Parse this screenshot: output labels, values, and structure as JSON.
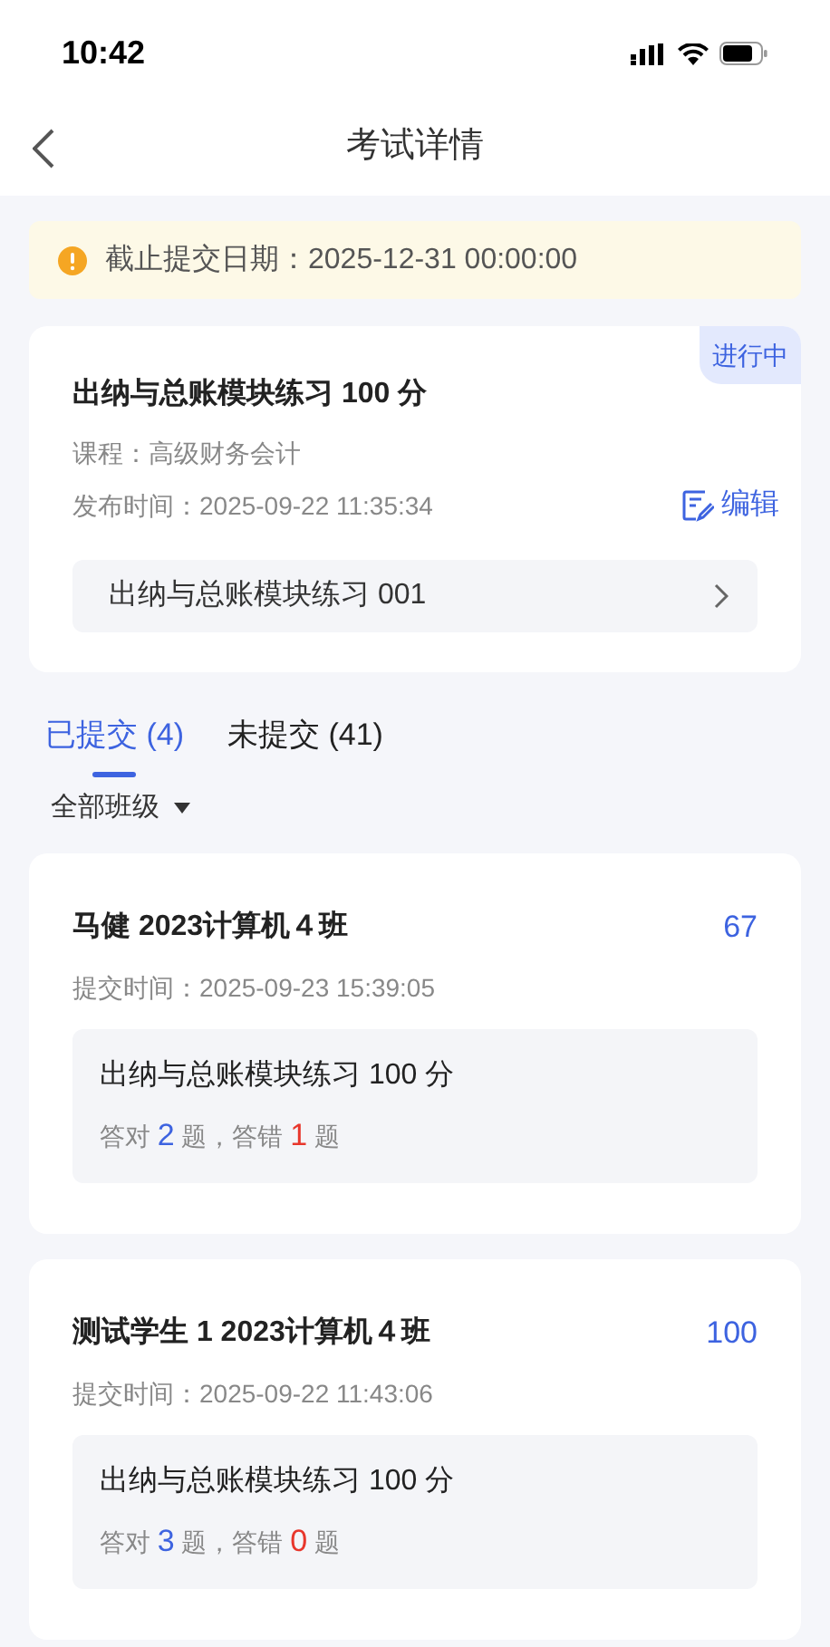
{
  "status_bar": {
    "time": "10:42"
  },
  "nav": {
    "title": "考试详情"
  },
  "notice": {
    "text": "截止提交日期：2025-12-31 00:00:00"
  },
  "exam": {
    "title": "出纳与总账模块练习 100 分",
    "status": "进行中",
    "course": "课程：高级财务会计",
    "published": "发布时间：2025-09-22 11:35:34",
    "edit": "编辑",
    "paper": "出纳与总账模块练习 001"
  },
  "tabs": [
    {
      "label": "已提交 (4)",
      "selected": true
    },
    {
      "label": "未提交 (41)",
      "selected": false
    }
  ],
  "filter": {
    "label": "全部班级"
  },
  "submissions": [
    {
      "student": "马健 2023计算机４班",
      "score": "67",
      "submitted": "提交时间：2025-09-23 15:39:05",
      "paper": "出纳与总账模块练习 100 分",
      "correct_label": "答对 ",
      "correct": "2",
      "correct_unit": " 题，",
      "wrong_label": "答错 ",
      "wrong": "1",
      "wrong_unit": " 题"
    },
    {
      "student": "测试学生 1 2023计算机４班",
      "score": "100",
      "submitted": "提交时间：2025-09-22 11:43:06",
      "paper": "出纳与总账模块练习 100 分",
      "correct_label": "答对 ",
      "correct": "3",
      "correct_unit": " 题，",
      "wrong_label": "答错 ",
      "wrong": "0",
      "wrong_unit": " 题"
    }
  ]
}
